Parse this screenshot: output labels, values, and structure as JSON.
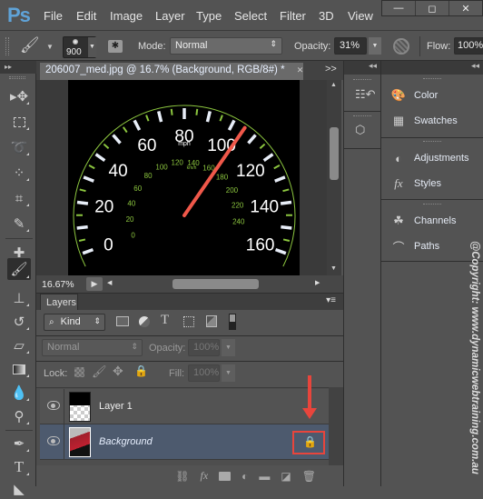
{
  "app": {
    "logo": "Ps"
  },
  "menu": [
    "File",
    "Edit",
    "Image",
    "Layer",
    "Type",
    "Select",
    "Filter",
    "3D",
    "View"
  ],
  "window_controls": {
    "minimize": "—",
    "maximize": "◻",
    "close": "✕"
  },
  "options_bar": {
    "brush_size": "900",
    "mode_label": "Mode:",
    "mode_value": "Normal",
    "opacity_label": "Opacity:",
    "opacity_value": "31%",
    "flow_label": "Flow:",
    "flow_value": "100%"
  },
  "tools": [
    "move",
    "rectangular-marquee",
    "lasso",
    "quick-selection",
    "crop",
    "eyedropper",
    "spot-healing",
    "brush",
    "clone-stamp",
    "history-brush",
    "eraser",
    "gradient",
    "blur",
    "dodge",
    "pen",
    "type",
    "path-selection"
  ],
  "active_tool": "brush",
  "document": {
    "tab_title": "206007_med.jpg @ 16.7% (Background, RGB/8#) *",
    "close": "✕",
    "collapse": ">>",
    "zoom_level": "16.67%"
  },
  "speedometer": {
    "mph_labels": [
      "0",
      "20",
      "40",
      "60",
      "80",
      "100",
      "120",
      "140",
      "160"
    ],
    "kmh_labels": [
      "0",
      "20",
      "40",
      "60",
      "80",
      "100",
      "120",
      "140",
      "160",
      "180",
      "200",
      "220",
      "240"
    ],
    "unit_mph": "mph",
    "unit_kmh": "km/h",
    "needle_mph": 105,
    "accent_green": "#8cc63f",
    "needle_color": "#f0584a"
  },
  "layers_panel": {
    "tab": "Layers",
    "filter_kind": "Kind",
    "blend_mode": "Normal",
    "opacity_label": "Opacity:",
    "opacity_value": "100%",
    "lock_label": "Lock:",
    "fill_label": "Fill:",
    "fill_value": "100%",
    "layers": [
      {
        "name": "Layer 1",
        "visible": true,
        "selected": false
      },
      {
        "name": "Background",
        "visible": true,
        "selected": true,
        "locked": true
      }
    ]
  },
  "right_panels": {
    "groups": [
      [
        "Color",
        "Swatches"
      ],
      [
        "Adjustments",
        "Styles"
      ],
      [
        "Channels",
        "Paths"
      ]
    ]
  },
  "watermark": "@Copyright: www.dynamicwebtraining.com.au",
  "colors": {
    "highlight": "#e8453c",
    "selected_row": "#4d5a6e",
    "background": "#535353"
  }
}
